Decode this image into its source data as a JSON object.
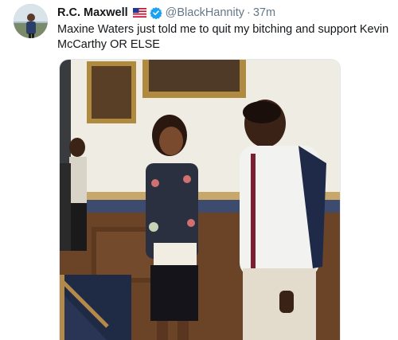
{
  "tweet": {
    "author": {
      "display_name": "R.C. Maxwell",
      "flag_icon": "us-flag-icon",
      "verified_icon": "verified-badge-icon",
      "handle": "@BlackHannity",
      "separator": "·",
      "time": "37m"
    },
    "text": "Maxine Waters just told me to quit my bitching and support Kevin McCarthy OR ELSE",
    "media": {
      "type": "photo"
    }
  },
  "colors": {
    "name": "#14171a",
    "secondary": "#657786",
    "verified": "#1da1f2"
  }
}
